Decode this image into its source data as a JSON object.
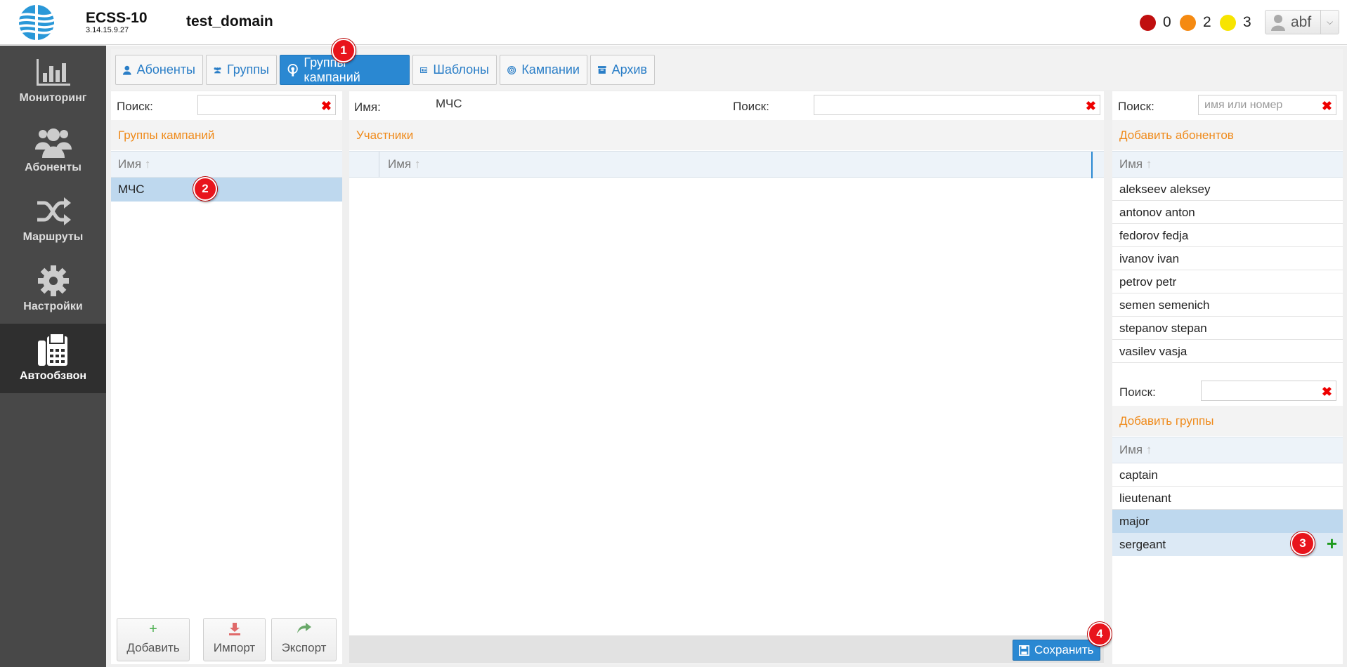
{
  "app": {
    "name": "ECSS-10",
    "version": "3.14.15.9.27",
    "domain": "test_domain"
  },
  "alarms": [
    {
      "color": "#c00f0f",
      "count": "0"
    },
    {
      "color": "#f58a12",
      "count": "2"
    },
    {
      "color": "#f7e400",
      "count": "3"
    }
  ],
  "user": {
    "name": "abf"
  },
  "sidebar": {
    "items": [
      {
        "label": "Мониторинг",
        "icon": "bar-chart-icon"
      },
      {
        "label": "Абоненты",
        "icon": "users-icon"
      },
      {
        "label": "Маршруты",
        "icon": "shuffle-icon"
      },
      {
        "label": "Настройки",
        "icon": "gear-icon"
      },
      {
        "label": "Автообзвон",
        "icon": "fax-icon"
      }
    ]
  },
  "tabs": [
    {
      "label": "Абоненты",
      "icon": "user-icon"
    },
    {
      "label": "Группы",
      "icon": "users-icon"
    },
    {
      "label": "Группы кампаний",
      "icon": "podcast-icon"
    },
    {
      "label": "Шаблоны",
      "icon": "newspaper-icon"
    },
    {
      "label": "Кампании",
      "icon": "target-icon"
    },
    {
      "label": "Архив",
      "icon": "archive-icon"
    }
  ],
  "left_panel": {
    "search_label": "Поиск:",
    "section_title": "Группы кампаний",
    "column_name": "Имя",
    "rows": [
      "МЧС"
    ],
    "buttons": {
      "add": "Добавить",
      "import": "Импорт",
      "export": "Экспорт"
    }
  },
  "middle_panel": {
    "name_label": "Имя:",
    "name_value": "МЧС",
    "search_label": "Поиск:",
    "section_title": "Участники",
    "column_name": "Имя",
    "save_label": "Сохранить"
  },
  "right_panel": {
    "search_label": "Поиск:",
    "search_placeholder": "имя или номер",
    "add_subscribers_title": "Добавить абонентов",
    "column_name": "Имя",
    "subscribers": [
      "alekseev aleksey",
      "antonov anton",
      "fedorov fedja",
      "ivanov ivan",
      "petrov petr",
      "semen semenich",
      "stepanov stepan",
      "vasilev vasja"
    ],
    "search2_label": "Поиск:",
    "add_groups_title": "Добавить группы",
    "groups": [
      "captain",
      "lieutenant",
      "major",
      "sergeant"
    ]
  },
  "badges": [
    "1",
    "2",
    "3",
    "4"
  ]
}
